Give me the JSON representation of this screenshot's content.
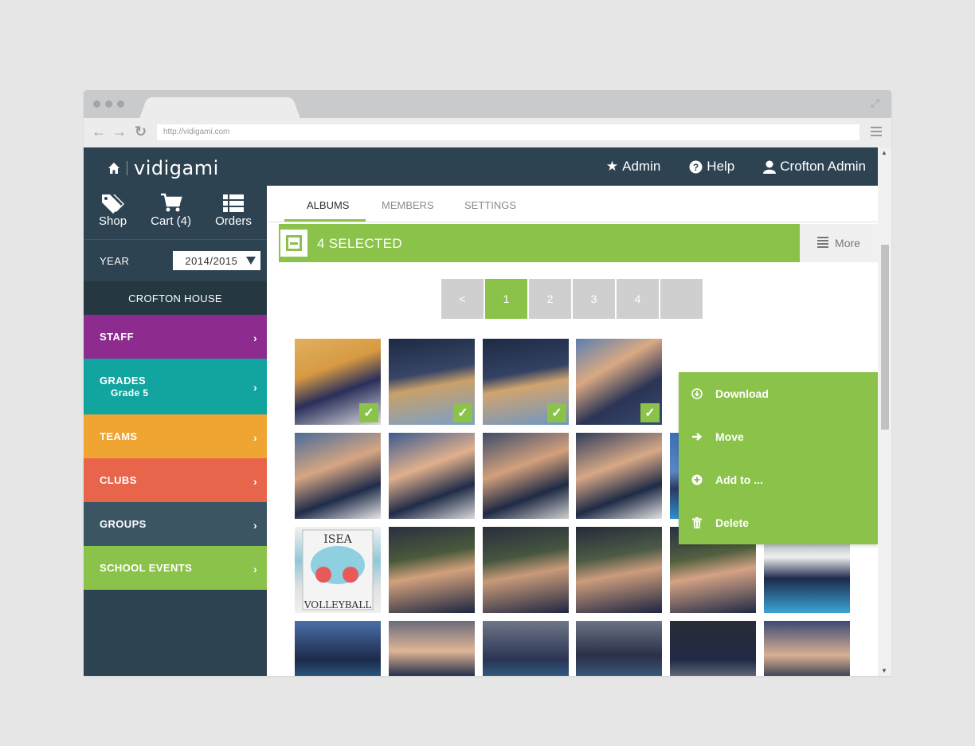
{
  "browser": {
    "url": "http://vidigami.com"
  },
  "header": {
    "brand": "vidigami",
    "links": [
      {
        "icon": "star-icon",
        "label": "Admin"
      },
      {
        "icon": "help-icon",
        "label": "Help"
      },
      {
        "icon": "user-icon",
        "label": "Crofton Admin"
      }
    ]
  },
  "sidebar": {
    "tools": [
      {
        "icon": "tag-icon",
        "label": "Shop"
      },
      {
        "icon": "cart-icon",
        "label": "Cart (4)"
      },
      {
        "icon": "list-icon",
        "label": "Orders"
      }
    ],
    "year_label": "YEAR",
    "year_value": "2014/2015",
    "school": "CROFTON HOUSE",
    "categories": [
      {
        "label": "STAFF",
        "sub": "",
        "color": "#8e2b8f"
      },
      {
        "label": "GRADES",
        "sub": "Grade 5",
        "color": "#12a5a0"
      },
      {
        "label": "TEAMS",
        "sub": "",
        "color": "#f0a431"
      },
      {
        "label": "CLUBS",
        "sub": "",
        "color": "#e8654b"
      },
      {
        "label": "GROUPS",
        "sub": "",
        "color": "#3b5563"
      },
      {
        "label": "SCHOOL EVENTS",
        "sub": "",
        "color": "#8bc34a"
      }
    ]
  },
  "tabs": [
    "ALBUMS",
    "MEMBERS",
    "SETTINGS"
  ],
  "selection": {
    "text": "4 SELECTED",
    "more_label": "More"
  },
  "pager": [
    "<",
    "1",
    "2",
    "3",
    "4"
  ],
  "dropdown": [
    {
      "icon": "download-icon",
      "label": "Download"
    },
    {
      "icon": "arrow-right-icon",
      "label": "Move"
    },
    {
      "icon": "plus-circle-icon",
      "label": "Add to ..."
    },
    {
      "icon": "trash-icon",
      "label": "Delete"
    }
  ],
  "colors": {
    "accent": "#8bc34a",
    "navy": "#2d4351"
  }
}
